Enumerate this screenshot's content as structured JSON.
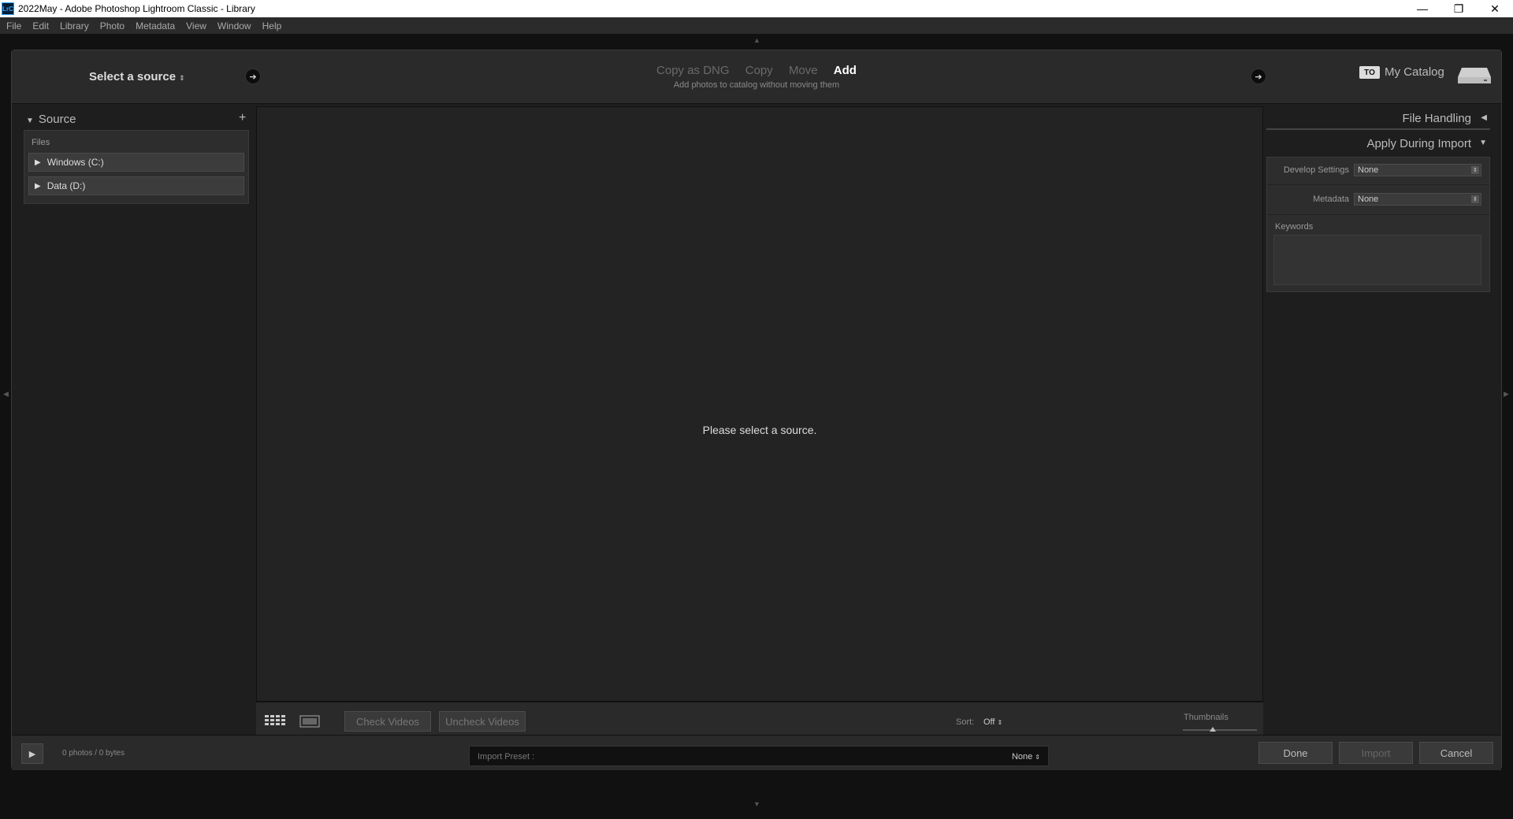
{
  "window": {
    "app_icon": "LrC",
    "title": "2022May - Adobe Photoshop Lightroom Classic - Library",
    "minimize": "—",
    "maximize": "❐",
    "close": "✕"
  },
  "menu": [
    "File",
    "Edit",
    "Library",
    "Photo",
    "Metadata",
    "View",
    "Window",
    "Help"
  ],
  "header": {
    "source_select": "Select a source",
    "modes": [
      "Copy as DNG",
      "Copy",
      "Move",
      "Add"
    ],
    "active_mode": "Add",
    "mode_description": "Add photos to catalog without moving them",
    "to_badge": "TO",
    "catalog_name": "My Catalog"
  },
  "left_panel": {
    "title": "Source",
    "add_symbol": "+",
    "files_label": "Files",
    "drives": [
      {
        "label": "Windows (C:)"
      },
      {
        "label": "Data (D:)"
      }
    ]
  },
  "center": {
    "message": "Please select a source.",
    "check_videos": "Check Videos",
    "uncheck_videos": "Uncheck Videos",
    "sort_label": "Sort:",
    "sort_value": "Off",
    "thumbnails_label": "Thumbnails",
    "thumbnail_size_fraction": 0.4
  },
  "right_panel": {
    "file_handling": "File Handling",
    "apply_during_import": "Apply During Import",
    "develop_settings_label": "Develop Settings",
    "develop_settings_value": "None",
    "metadata_label": "Metadata",
    "metadata_value": "None",
    "keywords_label": "Keywords"
  },
  "footer": {
    "photo_count": "0 photos / 0 bytes",
    "import_preset_label": "Import Preset :",
    "import_preset_value": "None",
    "done": "Done",
    "import": "Import",
    "cancel": "Cancel"
  }
}
